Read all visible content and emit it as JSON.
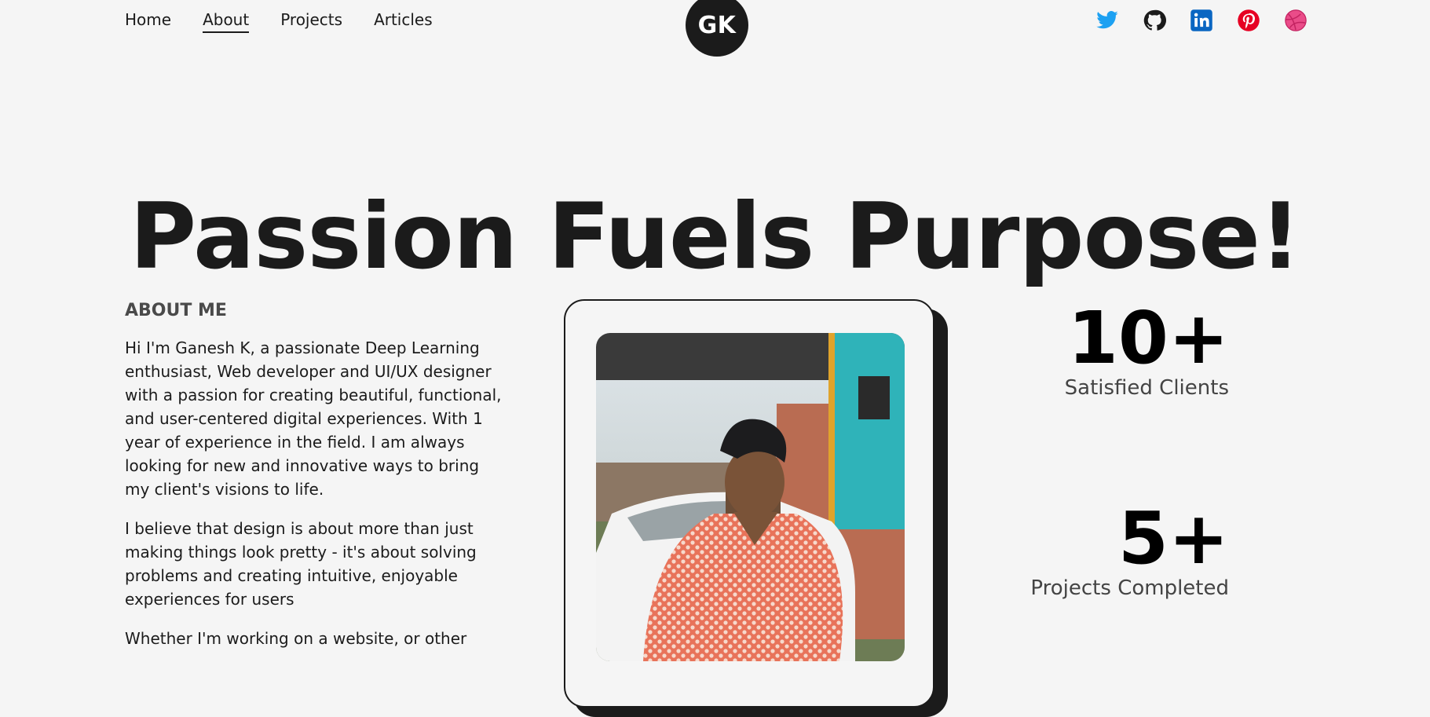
{
  "nav": {
    "links": [
      {
        "label": "Home",
        "active": false
      },
      {
        "label": "About",
        "active": true
      },
      {
        "label": "Projects",
        "active": false
      },
      {
        "label": "Articles",
        "active": false
      }
    ],
    "logo_text": "GK",
    "social": [
      {
        "icon": "twitter-icon",
        "color": "#1da1f2"
      },
      {
        "icon": "github-icon",
        "color": "#1b1b1b"
      },
      {
        "icon": "linkedin-icon",
        "color": "#0a66c2"
      },
      {
        "icon": "pinterest-icon",
        "color": "#e60023"
      },
      {
        "icon": "dribbble-icon",
        "color": "#ea4c89"
      }
    ]
  },
  "hero": {
    "title": "Passion Fuels Purpose!"
  },
  "about": {
    "heading": "ABOUT ME",
    "paragraphs": [
      "Hi I'm Ganesh K, a passionate Deep Learning enthusiast, Web developer and UI/UX designer with a passion for creating beautiful, functional, and user-centered digital experiences. With 1 year of experience in the field. I am always looking for new and innovative ways to bring my client's visions to life.",
      "I believe that design is about more than just making things look pretty - it's about solving problems and creating intuitive, enjoyable experiences for users",
      "Whether I'm working on a website, or other"
    ]
  },
  "stats": [
    {
      "value": "10+",
      "label": "Satisfied Clients"
    },
    {
      "value": "5+",
      "label": "Projects Completed"
    }
  ],
  "colors": {
    "background": "#f5f5f5",
    "text": "#1b1b1b",
    "accent": "#1b1b1b"
  }
}
